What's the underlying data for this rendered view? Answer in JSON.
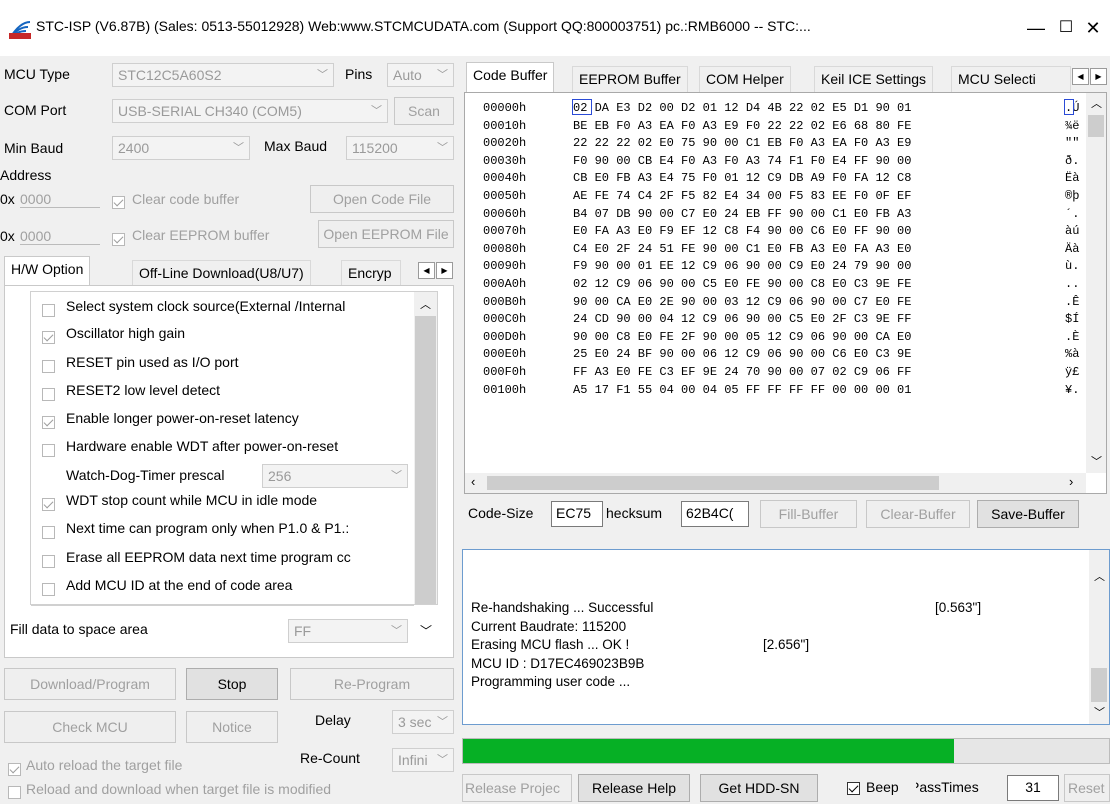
{
  "window": {
    "title": "STC-ISP (V6.87B) (Sales: 0513-55012928) Web:www.STCMCUDATA.com  (Support QQ:800003751) pc.:RMB6000 -- STC:...",
    "minimize": "—",
    "maximize": "☐",
    "close": "✕"
  },
  "left": {
    "mcu_type_label": "MCU Type",
    "mcu_type_value": "STC12C5A60S2",
    "pins_label": "Pins",
    "pins_value": "Auto",
    "com_port_label": "COM Port",
    "com_port_value": "USB-SERIAL CH340 (COM5)",
    "scan_label": "Scan",
    "min_baud_label": "Min Baud",
    "min_baud_value": "2400",
    "max_baud_label": "Max Baud",
    "max_baud_value": "115200",
    "address_label": "Address",
    "addr1_prefix": "0x",
    "addr1_value": "0000",
    "clear_code_label": "Clear code buffer",
    "open_code_label": "Open Code File",
    "addr2_prefix": "0x",
    "addr2_value": "0000",
    "clear_eeprom_label": "Clear EEPROM buffer",
    "open_eeprom_label": "Open EEPROM File",
    "tabs": [
      "H/W Option",
      "Off-Line Download(U8/U7)",
      "Encryp"
    ],
    "options": [
      {
        "label": "Select system clock source(External /Internal",
        "checked": false
      },
      {
        "label": "Oscillator high gain",
        "checked": true
      },
      {
        "label": "RESET pin used as I/O port",
        "checked": false
      },
      {
        "label": "RESET2 low level detect",
        "checked": false
      },
      {
        "label": "Enable longer power-on-reset latency",
        "checked": true
      },
      {
        "label": "Hardware enable WDT after power-on-reset",
        "checked": false
      }
    ],
    "wdt_prescal_label": "Watch-Dog-Timer prescal",
    "wdt_prescal_value": "256",
    "options2": [
      {
        "label": "WDT stop count while MCU in idle mode",
        "checked": true
      },
      {
        "label": "Next time can program only when P1.0 & P1.:",
        "checked": false
      },
      {
        "label": "Erase all EEPROM data next time program cc",
        "checked": false
      },
      {
        "label": "Add MCU ID at the end of code area",
        "checked": false
      }
    ],
    "fill_label": "Fill data to space area",
    "fill_value": "FF",
    "download_label": "Download/Program",
    "stop_label": "Stop",
    "reprogram_label": "Re-Program",
    "check_mcu_label": "Check MCU",
    "notice_label": "Notice",
    "delay_label": "Delay",
    "delay_value": "3 sec",
    "auto_reload_label": "Auto reload the target file",
    "recount_label": "Re-Count",
    "recount_value": "Infini",
    "reload_download_label": "Reload and download when target file is modified"
  },
  "right": {
    "tabs": [
      "Code Buffer",
      "EEPROM Buffer",
      "COM Helper",
      "Keil ICE Settings",
      "MCU Selecti"
    ],
    "hex_rows": [
      {
        "addr": "00000h",
        "bytes": "02 DA E3 D2 00 D2 01 12 D4 4B 22 02 E5 D1 90 01",
        "ascii": ".Ú"
      },
      {
        "addr": "00010h",
        "bytes": "BE EB F0 A3 EA F0 A3 E9 F0 22 22 02 E6 68 80 FE",
        "ascii": "¾ë"
      },
      {
        "addr": "00020h",
        "bytes": "22 22 22 02 E0 75 90 00 C1 EB F0 A3 EA F0 A3 E9",
        "ascii": "\"\""
      },
      {
        "addr": "00030h",
        "bytes": "F0 90 00 CB E4 F0 A3 F0 A3 74 F1 F0 E4 FF 90 00",
        "ascii": "ð."
      },
      {
        "addr": "00040h",
        "bytes": "CB E0 FB A3 E4 75 F0 01 12 C9 DB A9 F0 FA 12 C8",
        "ascii": "Ëà"
      },
      {
        "addr": "00050h",
        "bytes": "AE FE 74 C4 2F F5 82 E4 34 00 F5 83 EE F0 0F EF",
        "ascii": "®þ"
      },
      {
        "addr": "00060h",
        "bytes": "B4 07 DB 90 00 C7 E0 24 EB FF 90 00 C1 E0 FB A3",
        "ascii": "´."
      },
      {
        "addr": "00070h",
        "bytes": "E0 FA A3 E0 F9 EF 12 C8 F4 90 00 C6 E0 FF 90 00",
        "ascii": "àú"
      },
      {
        "addr": "00080h",
        "bytes": "C4 E0 2F 24 51 FE 90 00 C1 E0 FB A3 E0 FA A3 E0",
        "ascii": "Äà"
      },
      {
        "addr": "00090h",
        "bytes": "F9 90 00 01 EE 12 C9 06 90 00 C9 E0 24 79 90 00",
        "ascii": "ù."
      },
      {
        "addr": "000A0h",
        "bytes": "02 12 C9 06 90 00 C5 E0 FE 90 00 C8 E0 C3 9E FE",
        "ascii": ".."
      },
      {
        "addr": "000B0h",
        "bytes": "90 00 CA E0 2E 90 00 03 12 C9 06 90 00 C7 E0 FE",
        "ascii": ".Ê"
      },
      {
        "addr": "000C0h",
        "bytes": "24 CD 90 00 04 12 C9 06 90 00 C5 E0 2F C3 9E FF",
        "ascii": "$Í"
      },
      {
        "addr": "000D0h",
        "bytes": "90 00 C8 E0 FE 2F 90 00 05 12 C9 06 90 00 CA E0",
        "ascii": ".È"
      },
      {
        "addr": "000E0h",
        "bytes": "25 E0 24 BF 90 00 06 12 C9 06 90 00 C6 E0 C3 9E",
        "ascii": "%à"
      },
      {
        "addr": "000F0h",
        "bytes": "FF A3 E0 FE C3 EF 9E 24 70 90 00 07 02 C9 06 FF",
        "ascii": "ÿ£"
      },
      {
        "addr": "00100h",
        "bytes": "A5 17 F1 55 04 00 04 05 FF FF FF FF 00 00 00 01",
        "ascii": "¥."
      }
    ],
    "code_size_label": "Code-Size",
    "code_size_value": "EC75",
    "checksum_label": "hecksum",
    "checksum_value": "62B4C(",
    "fill_buffer_label": "Fill-Buffer",
    "clear_buffer_label": "Clear-Buffer",
    "save_buffer_label": "Save-Buffer",
    "log": [
      {
        "text": "Re-handshaking ... Successful",
        "time": "[0.563\"]"
      },
      {
        "text": "Current Baudrate: 115200",
        "time": ""
      },
      {
        "text": "Erasing MCU flash ...  OK !",
        "time": "[2.656\"]"
      },
      {
        "text": "MCU ID : D17EC469023B9B",
        "time": ""
      },
      {
        "text": "Programming user code ...",
        "time": ""
      }
    ],
    "progress": 0.76,
    "release_project_label": "Release Projec",
    "release_help_label": "Release Help",
    "get_hdd_label": "Get HDD-SN",
    "beep_label": "Beep",
    "passtimes_label": "PassTimes",
    "passtimes_value": "31",
    "reset_label": "Reset"
  },
  "colors": {
    "progress": "#06b025",
    "log_border": "#6d9ccf",
    "cursor": "#2a4bd7"
  }
}
